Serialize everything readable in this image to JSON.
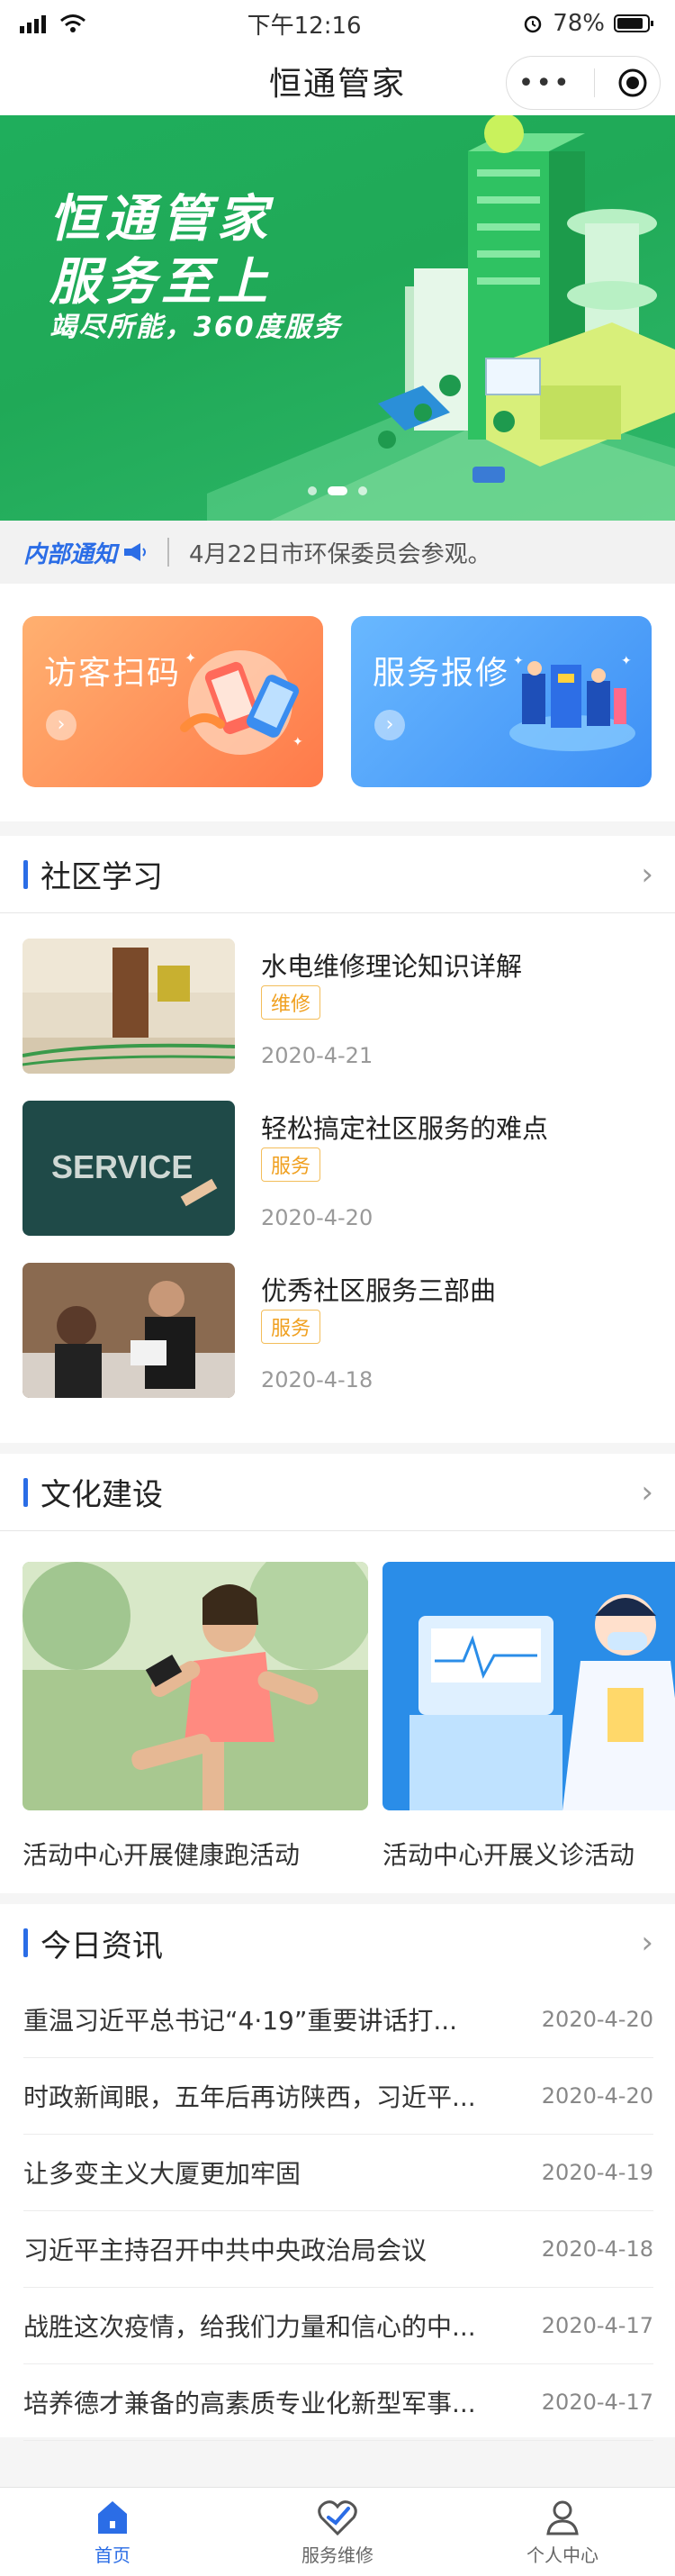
{
  "status": {
    "carrier": "",
    "time": "下午12:16",
    "battery": "78%"
  },
  "navbar": {
    "title": "恒通管家"
  },
  "banner": {
    "title1": "恒通管家",
    "title2": "服务至上",
    "tagline": "竭尽所能，360度服务"
  },
  "notice": {
    "tag": "内部通知",
    "text": "4月22日市环保委员会参观。"
  },
  "cards": [
    {
      "label": "访客扫码"
    },
    {
      "label": "服务报修"
    }
  ],
  "learning": {
    "title": "社区学习",
    "items": [
      {
        "title": "水电维修理论知识详解",
        "tag": "维修",
        "date": "2020-4-21"
      },
      {
        "title": "轻松搞定社区服务的难点",
        "tag": "服务",
        "date": "2020-4-20",
        "image_text": "SERVICE"
      },
      {
        "title": "优秀社区服务三部曲",
        "tag": "服务",
        "date": "2020-4-18"
      }
    ]
  },
  "culture": {
    "title": "文化建设",
    "items": [
      {
        "caption": "活动中心开展健康跑活动"
      },
      {
        "caption": "活动中心开展义诊活动"
      }
    ]
  },
  "news": {
    "title": "今日资讯",
    "items": [
      {
        "title": "重温习近平总书记“4·19”重要讲话打...",
        "date": "2020-4-20"
      },
      {
        "title": "时政新闻眼，五年后再访陕西，习近平...",
        "date": "2020-4-20"
      },
      {
        "title": "让多变主义大厦更加牢固",
        "date": "2020-4-19"
      },
      {
        "title": "习近平主持召开中共中央政治局会议",
        "date": "2020-4-18"
      },
      {
        "title": "战胜这次疫情，给我们力量和信心的中...",
        "date": "2020-4-17"
      },
      {
        "title": "培养德才兼备的高素质专业化新型军事...",
        "date": "2020-4-17"
      }
    ]
  },
  "tabbar": [
    {
      "label": "首页",
      "icon": "home-icon"
    },
    {
      "label": "服务维修",
      "icon": "heart-check-icon"
    },
    {
      "label": "个人中心",
      "icon": "user-icon"
    }
  ],
  "colors": {
    "accent": "#2b6de6",
    "banner_green": "#20a957",
    "tag_orange": "#f0a020"
  }
}
